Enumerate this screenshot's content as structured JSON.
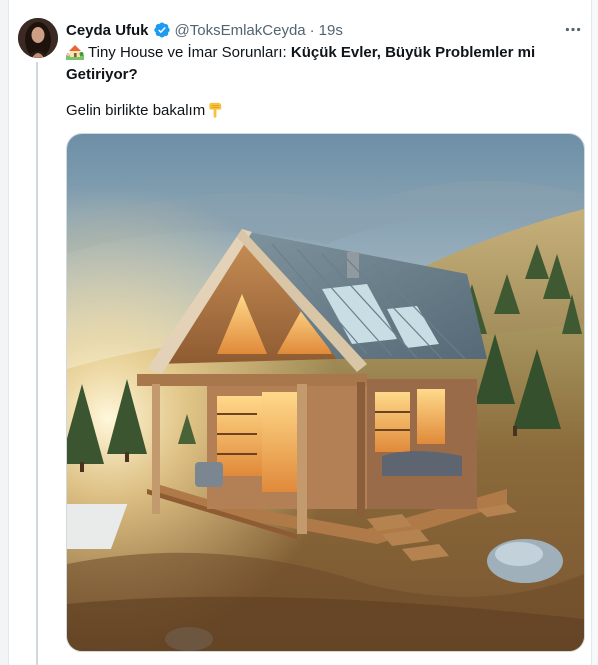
{
  "tweet": {
    "author": {
      "display_name": "Ceyda Ufuk",
      "handle": "@ToksEmlakCeyda",
      "verified": true,
      "avatar_icon": "avatar-photo"
    },
    "separator": "·",
    "time": "19s",
    "text": {
      "emoji_icon": "house-with-garden-emoji",
      "title_plain": "Tiny House ve İmar Sorunları: ",
      "title_bold_line1": "Küçük Evler, Büyük Problemler mi",
      "title_bold_line2": "Getiriyor?",
      "body": "Gelin birlikte bakalım",
      "body_emoji_icon": "backhand-index-pointing-down-emoji"
    },
    "media": {
      "type": "image",
      "subject": "tiny-house-illustration"
    },
    "more_icon": "more-horizontal-icon"
  },
  "colors": {
    "text_primary": "#0f1419",
    "text_secondary": "#536471",
    "verified_blue": "#1d9bf0",
    "border": "#cfd9de"
  }
}
